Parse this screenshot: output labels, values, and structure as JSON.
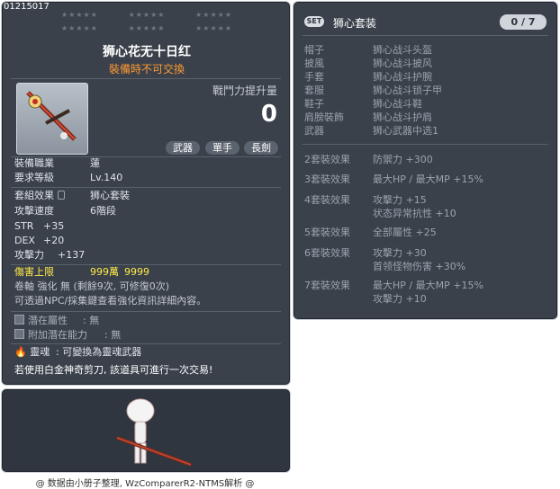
{
  "item": {
    "code": "01215017",
    "name": "狮心花无十日红",
    "untradable": "裝備時不可交換",
    "power_label": "戰鬥力提升量",
    "power_value": "0",
    "chips": [
      "武器",
      "單手",
      "長劍"
    ],
    "job_label": "裝備職業",
    "job_value": "蓮",
    "level_label": "要求等級",
    "level_value": "Lv.140",
    "set_label": "套組效果",
    "set_value": "狮心套裝",
    "speed_label": "攻擊速度",
    "speed_value": "6階段",
    "str_label": "STR",
    "str_value": "+35",
    "dex_label": "DEX",
    "dex_value": "+20",
    "atk_label": "攻擊力",
    "atk_value": "+137",
    "cap_label": "傷害上限",
    "cap_value_a": "999萬",
    "cap_value_b": "9999",
    "scroll_text": "卷軸 強化 無 (剩餘9次, 可修復0次)",
    "npc_text": "可透過NPC/採集鍵查看強化資訊詳細內容。",
    "potential_label": "潛在屬性",
    "potential_value": ": 無",
    "bonus_label": "附加潛在能力",
    "bonus_value": ": 無",
    "soul_label": "靈魂",
    "soul_value": ": 可變換為靈魂武器",
    "scissors_text": "若使用白金神奇剪刀, 該道具可進行一次交易!"
  },
  "set": {
    "badge": "SET",
    "title": "狮心套装",
    "count": "0 / 7",
    "pieces": [
      {
        "slot": "帽子",
        "name": "狮心战斗头盔"
      },
      {
        "slot": "披風",
        "name": "狮心战斗披风"
      },
      {
        "slot": "手套",
        "name": "狮心战斗护腕"
      },
      {
        "slot": "套服",
        "name": "狮心战斗锁子甲"
      },
      {
        "slot": "鞋子",
        "name": "狮心战斗鞋"
      },
      {
        "slot": "肩膀裝飾",
        "name": "狮心战斗护肩"
      },
      {
        "slot": "武器",
        "name": "狮心武器中选1"
      }
    ],
    "effects": [
      {
        "label": "2套裝效果",
        "lines": [
          "防禦力  +300"
        ]
      },
      {
        "label": "3套裝效果",
        "lines": [
          "最大HP / 最大MP  +15%"
        ]
      },
      {
        "label": "4套裝效果",
        "lines": [
          "攻擊力  +15",
          "状态异常抗性  +10"
        ]
      },
      {
        "label": "5套裝效果",
        "lines": [
          "全部屬性  +25"
        ]
      },
      {
        "label": "6套裝效果",
        "lines": [
          "攻擊力  +30",
          "首领怪物伤害  +30%"
        ]
      },
      {
        "label": "7套裝效果",
        "lines": [
          "最大HP / 最大MP  +15%",
          "攻擊力  +10"
        ]
      }
    ]
  },
  "footer": "@ 数据由小册子整理, WzComparerR2-NTMS解析 @"
}
